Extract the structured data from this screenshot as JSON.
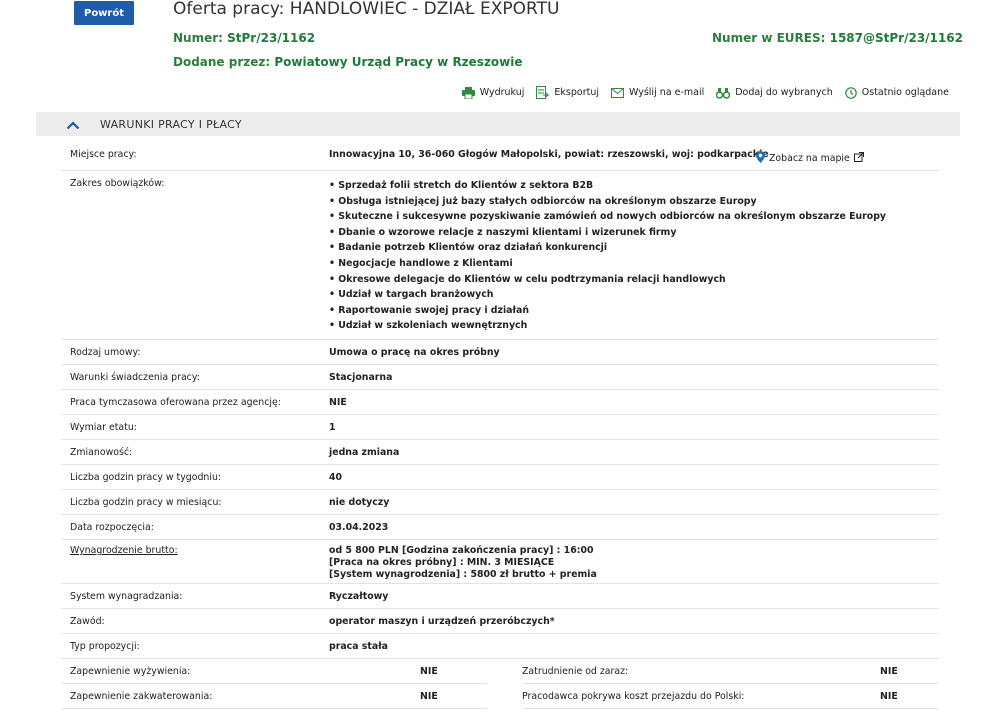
{
  "header": {
    "back_label": "Powrót",
    "title": "Oferta pracy: HANDLOWIEC - DZIAŁ EXPORTU",
    "number_key": "Numer: ",
    "number_val": "StPr/23/1162",
    "eures_key": "Numer w EURES: ",
    "eures_val": "1587@StPr/23/1162",
    "added_key": "Dodane przez: ",
    "added_val": "Powiatowy Urząd Pracy w Rzeszowie"
  },
  "actions": [
    {
      "label": "Wydrukuj",
      "icon": "printer-icon"
    },
    {
      "label": "Eksportuj",
      "icon": "export-icon"
    },
    {
      "label": "Wyślij na e-mail",
      "icon": "envelope-icon"
    },
    {
      "label": "Dodaj do wybranych",
      "icon": "binoculars-icon"
    },
    {
      "label": "Ostatnio oglądane",
      "icon": "clock-icon"
    }
  ],
  "section": {
    "title": "WARUNKI PRACY I PŁACY",
    "icon": "chevron-up-icon"
  },
  "location": {
    "label": "Miejsce pracy:",
    "value": "Innowacyjna 10, 36-060 Głogów Małopolski, powiat: rzeszowski, woj: podkarpackie",
    "map_label": "Zobacz na mapie"
  },
  "duties": {
    "label": "Zakres obowiązków:",
    "items": [
      "Sprzedaż folii stretch do Klientów z sektora B2B",
      "Obsługa istniejącej już bazy stałych odbiorców na określonym obszarze Europy",
      "Skuteczne i sukcesywne pozyskiwanie zamówień od nowych odbiorców na określonym obszarze Europy",
      "Dbanie o wzorowe relacje z naszymi klientami i wizerunek firmy",
      "Badanie potrzeb Klientów oraz działań konkurencji",
      "Negocjacje handlowe z Klientami",
      "Okresowe delegacje do Klientów w celu podtrzymania relacji handlowych",
      "Udział w targach branżowych",
      "Raportowanie swojej pracy i działań",
      "Udział w szkoleniach wewnętrznych"
    ]
  },
  "rows": [
    {
      "label": "Rodzaj umowy:",
      "value": "Umowa o pracę na okres próbny"
    },
    {
      "label": "Warunki świadczenia pracy:",
      "value": "Stacjonarna"
    },
    {
      "label": "Praca tymczasowa oferowana przez agencję:",
      "value": "NIE"
    },
    {
      "label": "Wymiar etatu:",
      "value": "1"
    },
    {
      "label": "Zmianowość:",
      "value": "jedna zmiana"
    },
    {
      "label": "Liczba godzin pracy w tygodniu:",
      "value": "40"
    },
    {
      "label": "Liczba godzin pracy w miesiącu:",
      "value": "nie dotyczy"
    },
    {
      "label": "Data rozpoczęcia:",
      "value": "03.04.2023"
    }
  ],
  "salary": {
    "label": "Wynagrodzenie brutto:",
    "lines": [
      "od 5 800 PLN [Godzina zakończenia pracy] : 16:00",
      "[Praca na okres próbny] : MIN. 3 MIESIĄCE",
      "[System wynagrodzenia] : 5800 zł brutto + premia"
    ]
  },
  "rows2": [
    {
      "label": "System wynagradzania:",
      "value": "Ryczałtowy"
    },
    {
      "label": "Zawód:",
      "value": "operator maszyn i urządzeń przeróbczych*"
    },
    {
      "label": "Typ propozycji:",
      "value": "praca stała"
    }
  ],
  "split": [
    {
      "left_label": "Zapewnienie wyżywienia:",
      "left_value": "NIE",
      "right_label": "Zatrudnienie od zaraz:",
      "right_value": "NIE"
    },
    {
      "left_label": "Zapewnienie zakwaterowania:",
      "left_value": "NIE",
      "right_label": "Pracodawca pokrywa koszt przejazdu do Polski:",
      "right_value": "NIE"
    }
  ],
  "colors": {
    "accent_blue": "#1f5da8",
    "green": "#1f7a3a",
    "map_pin": "#1d6fb8"
  }
}
